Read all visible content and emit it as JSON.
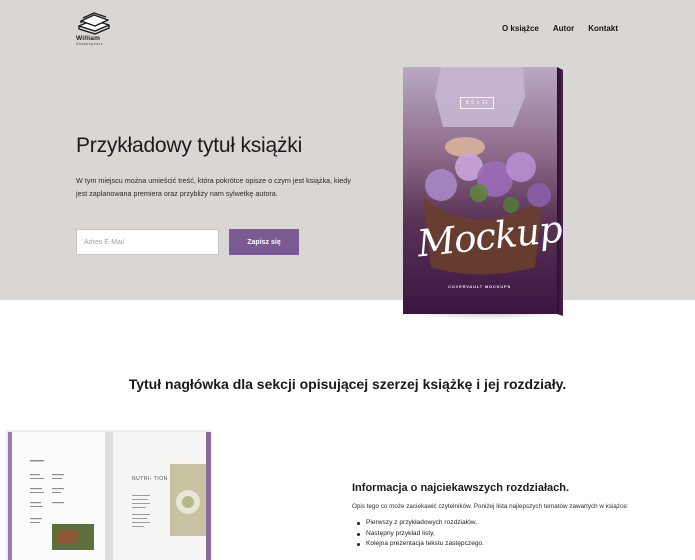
{
  "header": {
    "logo": {
      "name": "William",
      "subtitle": "Shakespeare",
      "icon": "stacked-books-icon"
    },
    "nav": [
      {
        "label": "O książce"
      },
      {
        "label": "Autor"
      },
      {
        "label": "Kontakt"
      }
    ]
  },
  "hero": {
    "title": "Przykładowy tytuł książki",
    "description": "W tym miejscu można umieścić treść, która pokrótce opisze o czym jest książka, kiedy jest zaplanowana premiera oraz przybliży nam sylwetkę autora.",
    "email_placeholder": "Adres E-Mail",
    "email_value": "",
    "subscribe_label": "Zapisz się",
    "accent_color": "#7b5a93",
    "background_color": "#dad6d4"
  },
  "book_cover": {
    "badge": "8.5 x 11",
    "title_script": "Mockup",
    "brand": "COVERVAULT MOCKUPS"
  },
  "chapters_section": {
    "title": "Tytuł nagłówka dla sekcji opisującej szerzej książkę i jej rozdziały.",
    "spread_page_word": "NUTRI-\nTION",
    "info_title": "Informacja o najciekawszych rozdziałach.",
    "info_description": "Opis tego co może zaciekawić czytelników. Poniżej lista najlepszych tematów zawartych w książce:",
    "items": [
      "Pierwszy z przykładowych rozdziałów,",
      "Następny przykład listy,",
      "Kolejna prezentacja tekstu zastępczego."
    ]
  }
}
